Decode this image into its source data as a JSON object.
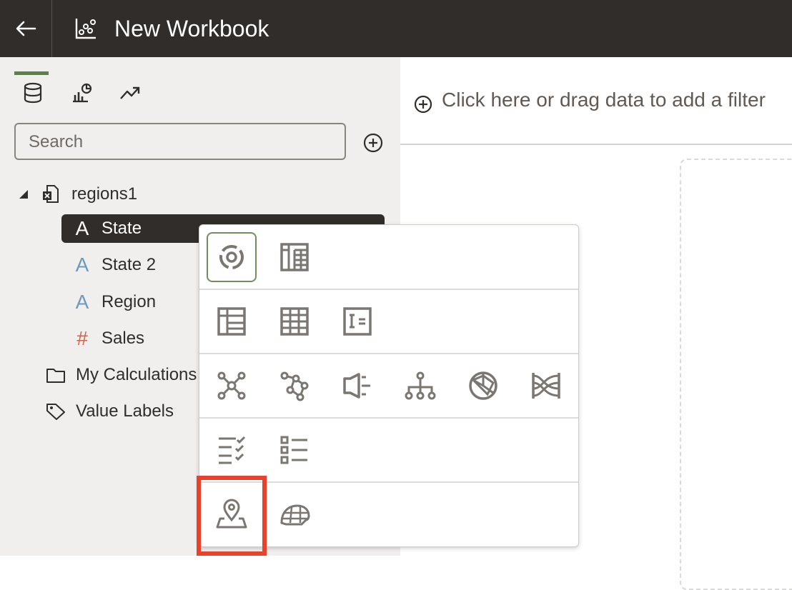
{
  "header": {
    "title": "New Workbook"
  },
  "sidebar": {
    "tabs": [
      {
        "icon": "database-icon",
        "active": true
      },
      {
        "icon": "visualizations-icon",
        "active": false
      },
      {
        "icon": "analytics-icon",
        "active": false
      }
    ],
    "search": {
      "placeholder": "Search",
      "value": ""
    },
    "tree": {
      "root_label": "regions1",
      "columns": [
        {
          "glyph": "A",
          "label": "State",
          "selected": true
        },
        {
          "glyph": "A",
          "label": "State 2",
          "selected": false
        },
        {
          "glyph": "A",
          "label": "Region",
          "selected": false
        },
        {
          "glyph": "#",
          "label": "Sales",
          "selected": false
        }
      ],
      "folders": [
        {
          "icon": "folder-icon",
          "label": "My Calculations"
        },
        {
          "icon": "tag-icon",
          "label": "Value Labels"
        }
      ]
    }
  },
  "filter_bar": {
    "text": "Click here or drag data to add a filter"
  },
  "colors": {
    "header_bg": "#312d2a",
    "panel_bg": "#f1efed",
    "accent_green": "#5f7d4f",
    "highlight_red": "#e8412c",
    "text_attr_blue": "#6c9bbf",
    "measure_red": "#c9664f"
  },
  "viz_picker": {
    "rows": [
      [
        "auto-visualization-icon",
        "pivot-icon"
      ],
      [
        "table-icon",
        "grid-icon",
        "list-table-icon"
      ],
      [
        "network-icon",
        "chord-icon",
        "funnel-icon",
        "tree-diagram-icon",
        "radar-icon",
        "sankey-icon"
      ],
      [
        "checklist-icon",
        "list-icon"
      ],
      [
        "map-icon",
        "geo-area-icon"
      ]
    ],
    "selected": "auto-visualization-icon",
    "highlighted": "map-icon"
  }
}
